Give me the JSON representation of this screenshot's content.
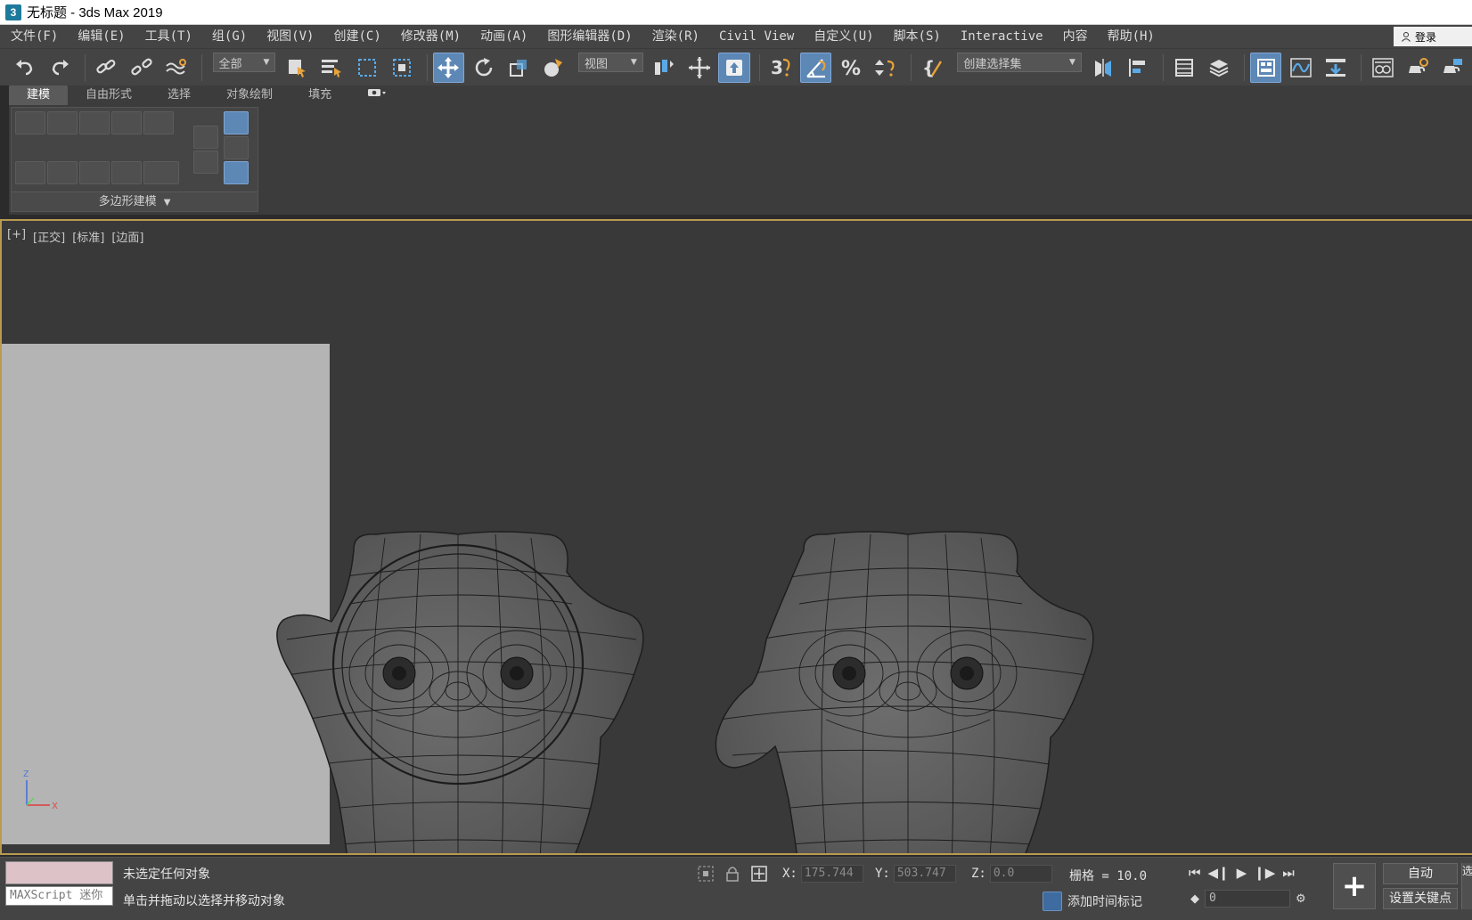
{
  "window": {
    "app_icon_text": "3",
    "title": "无标题 - 3ds Max 2019"
  },
  "menu": {
    "items": [
      "文件(F)",
      "编辑(E)",
      "工具(T)",
      "组(G)",
      "视图(V)",
      "创建(C)",
      "修改器(M)",
      "动画(A)",
      "图形编辑器(D)",
      "渲染(R)",
      "Civil View",
      "自定义(U)",
      "脚本(S)",
      "Interactive",
      "内容",
      "帮助(H)"
    ],
    "login_label": "登录"
  },
  "toolbar": {
    "selection_filter": "全部",
    "reference_coord": "视图",
    "named_selection": "创建选择集",
    "icons": [
      "undo-icon",
      "redo-icon",
      "link-icon",
      "unlink-icon",
      "bind-spacewarp-icon",
      "select-object-icon",
      "select-by-name-icon",
      "rect-region-icon",
      "window-crossing-icon",
      "select-move-icon",
      "select-rotate-icon",
      "select-scale-icon",
      "select-place-icon",
      "pivot-icon",
      "selection-lock-icon",
      "snap-3d-icon",
      "angle-snap-icon",
      "percent-snap-icon",
      "spinner-snap-icon",
      "edit-named-sets-icon",
      "mirror-icon",
      "align-icon",
      "scene-explorer-icon",
      "layer-explorer-icon",
      "ribbon-toggle-icon",
      "curve-editor-icon",
      "schematic-view-icon",
      "material-editor-icon",
      "render-setup-icon",
      "render-frame-icon"
    ]
  },
  "ribbon": {
    "tabs": [
      "建模",
      "自由形式",
      "选择",
      "对象绘制",
      "填充"
    ],
    "active_tab": "建模",
    "panel_title": "多边形建模"
  },
  "viewport": {
    "labels": [
      "[+]",
      "[正交]",
      "[标准]",
      "[边面]"
    ],
    "axis_z": "z",
    "axis_x": "x"
  },
  "status": {
    "selection_text": "未选定任何对象",
    "prompt_text": "单击并拖动以选择并移动对象",
    "maxscript_placeholder": "MAXScript 迷你",
    "x_label": "X:",
    "x_value": "175.744",
    "y_label": "Y:",
    "y_value": "503.747",
    "z_label": "Z:",
    "z_value": "0.0",
    "grid_text": "栅格 = 10.0",
    "add_time_tag": "添加时间标记",
    "frame_value": "0",
    "auto_key": "自动",
    "set_key": "设置关键点",
    "edge_stub": "选"
  },
  "colors": {
    "accent_active": "#5d87b5",
    "viewport_border": "#b89a50",
    "maxscript_listener": "#ddc2c8"
  }
}
